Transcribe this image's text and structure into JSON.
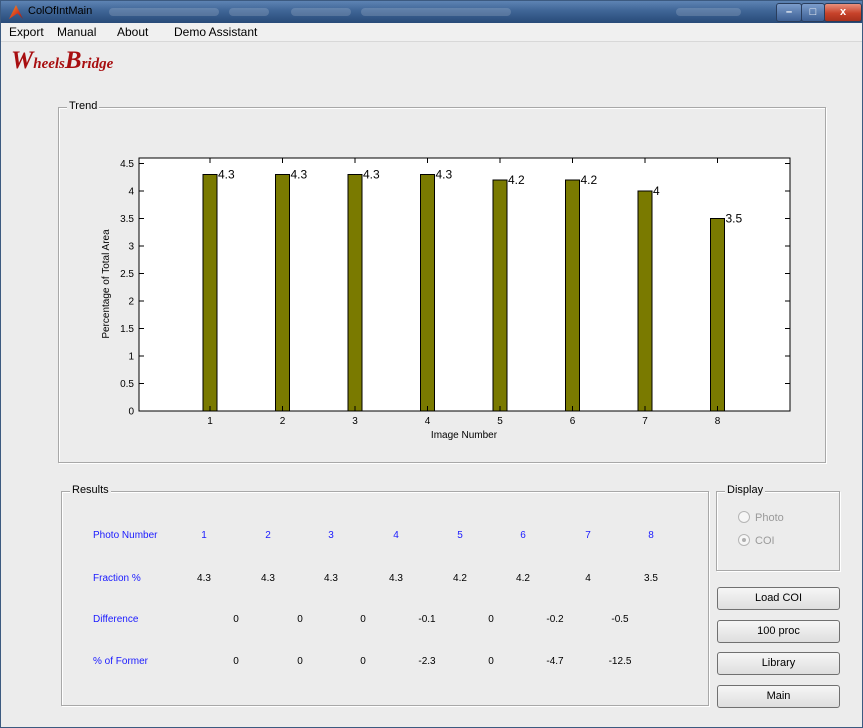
{
  "window": {
    "title": "ColOfIntMain"
  },
  "title_buttons": {
    "minimize": "–",
    "maximize": "□",
    "close": "x"
  },
  "menubar": [
    "Export",
    "Manual",
    "About",
    "Demo Assistant"
  ],
  "logo": {
    "first_cap": "W",
    "first_rest": "heels",
    "second_cap": "B",
    "second_rest": "ridge"
  },
  "trend": {
    "title": "Trend"
  },
  "chart_data": {
    "type": "bar",
    "categories": [
      "1",
      "2",
      "3",
      "4",
      "5",
      "6",
      "7",
      "8"
    ],
    "values": [
      4.3,
      4.3,
      4.3,
      4.3,
      4.2,
      4.2,
      4,
      3.5
    ],
    "data_labels": [
      "4.3",
      "4.3",
      "4.3",
      "4.3",
      "4.2",
      "4.2",
      "4",
      "3.5"
    ],
    "xlabel": "Image Number",
    "ylabel": "Percentage of Total Area",
    "ylim": [
      0,
      4.6
    ],
    "yticks": [
      "0",
      "0.5",
      "1",
      "1.5",
      "2",
      "2.5",
      "3",
      "3.5",
      "4",
      "4.5"
    ],
    "grid": false,
    "bar_color": "#7a7a00"
  },
  "results": {
    "title": "Results",
    "header_label": "Photo Number",
    "photo_numbers": [
      "1",
      "2",
      "3",
      "4",
      "5",
      "6",
      "7",
      "8"
    ],
    "fraction_label": "Fraction %",
    "fractions": [
      "4.3",
      "4.3",
      "4.3",
      "4.3",
      "4.2",
      "4.2",
      "4",
      "3.5"
    ],
    "difference_label": "Difference",
    "differences": [
      "0",
      "0",
      "0",
      "-0.1",
      "0",
      "-0.2",
      "-0.5"
    ],
    "former_label": "% of Former",
    "former": [
      "0",
      "0",
      "0",
      "-2.3",
      "0",
      "-4.7",
      "-12.5"
    ]
  },
  "display": {
    "title": "Display",
    "option_photo": "Photo",
    "option_coi": "COI",
    "selected": "COI"
  },
  "buttons": {
    "load": "Load COI",
    "proc": "100 proc",
    "library": "Library",
    "main": "Main"
  },
  "colors": {
    "label_blue": "#1a1aff",
    "logo_red": "#a80e10"
  }
}
